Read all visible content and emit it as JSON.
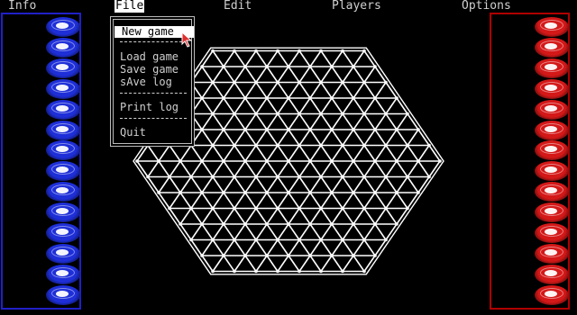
{
  "menu": {
    "items": [
      {
        "label": "Info"
      },
      {
        "label": "File"
      },
      {
        "label": "Edit"
      },
      {
        "label": "Players"
      },
      {
        "label": "Options"
      }
    ]
  },
  "file_menu": {
    "new_game": "New game",
    "load_game": "Load game",
    "save_game": "Save game",
    "save_log": "sAve log",
    "print_log": "Print log",
    "quit": "Quit"
  },
  "players": {
    "blue": {
      "color": "#1e2fd8",
      "pieces_remaining": 14
    },
    "red": {
      "color": "#d41818",
      "pieces_remaining": 14
    }
  },
  "board": {
    "shape": "hexagon-triangular-grid",
    "line_color": "#ffffff"
  }
}
